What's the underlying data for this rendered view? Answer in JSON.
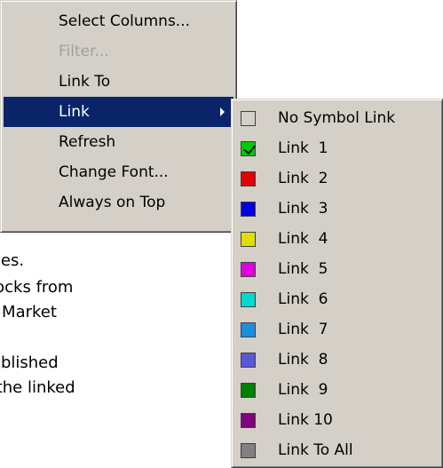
{
  "background_text": {
    "line1": "sheet changes.",
    "line2": "selected stocks from",
    "line3": "is linked to a Market",
    "line4": "a link is established",
    "line5": "manipulate the linked"
  },
  "context_menu": {
    "items": [
      {
        "label": "Select Columns...",
        "enabled": true
      },
      {
        "label": "Filter...",
        "enabled": false
      },
      {
        "label": "Link To",
        "enabled": true
      },
      {
        "label": "Link",
        "enabled": true,
        "selected": true,
        "has_submenu": true
      },
      {
        "label": "Refresh",
        "enabled": true
      },
      {
        "label": "Change Font...",
        "enabled": true
      },
      {
        "label": "Always on Top",
        "enabled": true
      }
    ]
  },
  "link_submenu": {
    "items": [
      {
        "label": "No Symbol Link",
        "color": "#d4d0c8",
        "checked": false,
        "icon": "empty-swatch-icon"
      },
      {
        "label": "Link  1",
        "color": "#00cc00",
        "checked": true,
        "icon": "green-check-swatch-icon"
      },
      {
        "label": "Link  2",
        "color": "#e00000",
        "checked": false,
        "icon": "red-swatch-icon"
      },
      {
        "label": "Link  3",
        "color": "#0000e0",
        "checked": false,
        "icon": "blue-swatch-icon"
      },
      {
        "label": "Link  4",
        "color": "#e0e000",
        "checked": false,
        "icon": "yellow-swatch-icon"
      },
      {
        "label": "Link  5",
        "color": "#e000e0",
        "checked": false,
        "icon": "magenta-swatch-icon"
      },
      {
        "label": "Link  6",
        "color": "#00d8d0",
        "checked": false,
        "icon": "cyan-swatch-icon"
      },
      {
        "label": "Link  7",
        "color": "#1a8fe0",
        "checked": false,
        "icon": "sky-blue-swatch-icon"
      },
      {
        "label": "Link  8",
        "color": "#5858d8",
        "checked": false,
        "icon": "slate-blue-swatch-icon"
      },
      {
        "label": "Link  9",
        "color": "#008000",
        "checked": false,
        "icon": "dark-green-swatch-icon"
      },
      {
        "label": "Link 10",
        "color": "#800080",
        "checked": false,
        "icon": "purple-swatch-icon"
      },
      {
        "label": "Link To All",
        "color": "#808080",
        "checked": false,
        "icon": "gray-swatch-icon"
      }
    ]
  },
  "colors": {
    "menu_background": "#d4d0c8",
    "selection": "#0a246a",
    "disabled_text": "#a0a0a0"
  }
}
